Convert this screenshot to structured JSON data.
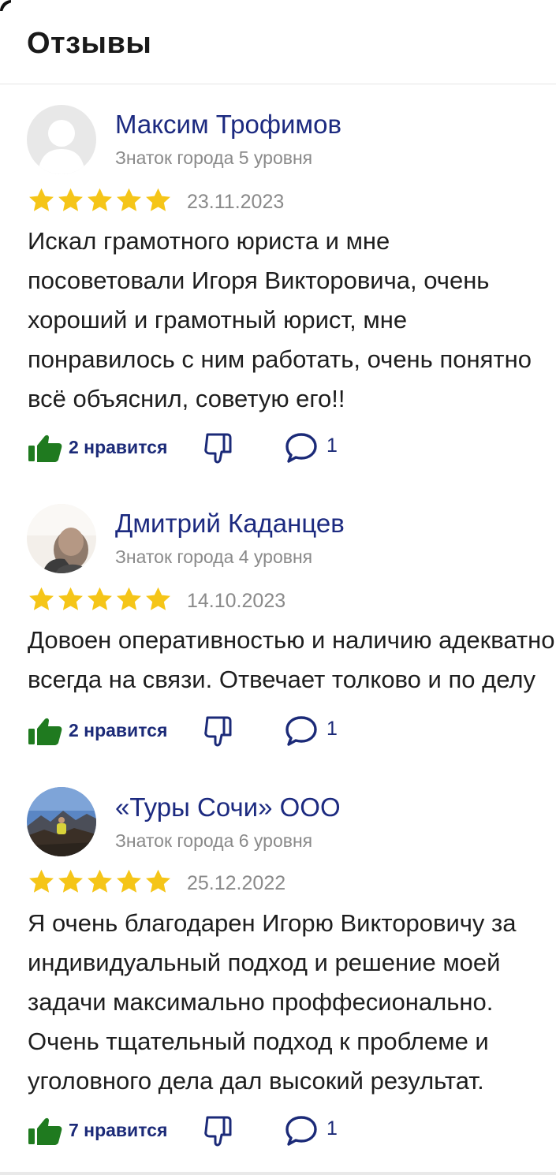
{
  "header": {
    "title": "Отзывы"
  },
  "colors": {
    "accent": "#1c2a80",
    "star": "#f5c518",
    "like": "#1f7a1f",
    "muted": "#8a8a8a"
  },
  "reviews": [
    {
      "author": "Максим Трофимов",
      "level": "Знаток города 5 уровня",
      "rating": 5,
      "date": "23.11.2023",
      "lines": [
        "Искал грамотного юриста и мне",
        "посоветовали Игоря Викторовича, очень",
        "хороший и грамотный юрист, мне",
        "понравилось с ним работать, очень понятно",
        "всё объяснил, советую его!!"
      ],
      "likes_label": "2 нравится",
      "comments": "1",
      "avatar": "placeholder-avatar"
    },
    {
      "author": "Дмитрий Каданцев",
      "level": "Знаток города 4 уровня",
      "rating": 5,
      "date": "14.10.2023",
      "lines": [
        "Довоен оперативностью и наличию адекватной",
        "всегда на связи. Отвечает толково и по делу"
      ],
      "likes_label": "2 нравится",
      "comments": "1",
      "avatar": "photo-avatar"
    },
    {
      "author": "«Туры Сочи» ООО",
      "level": "Знаток города 6 уровня",
      "rating": 5,
      "date": "25.12.2022",
      "lines": [
        "Я очень благодарен Игорю Викторовичу за",
        "индивидуальный подход и решение моей",
        "задачи максимально проффесионально.",
        "Очень тщательный подход к проблеме и",
        "уголовного дела дал высокий результат."
      ],
      "likes_label": "7 нравится",
      "comments": "1",
      "avatar": "photo-avatar"
    }
  ]
}
